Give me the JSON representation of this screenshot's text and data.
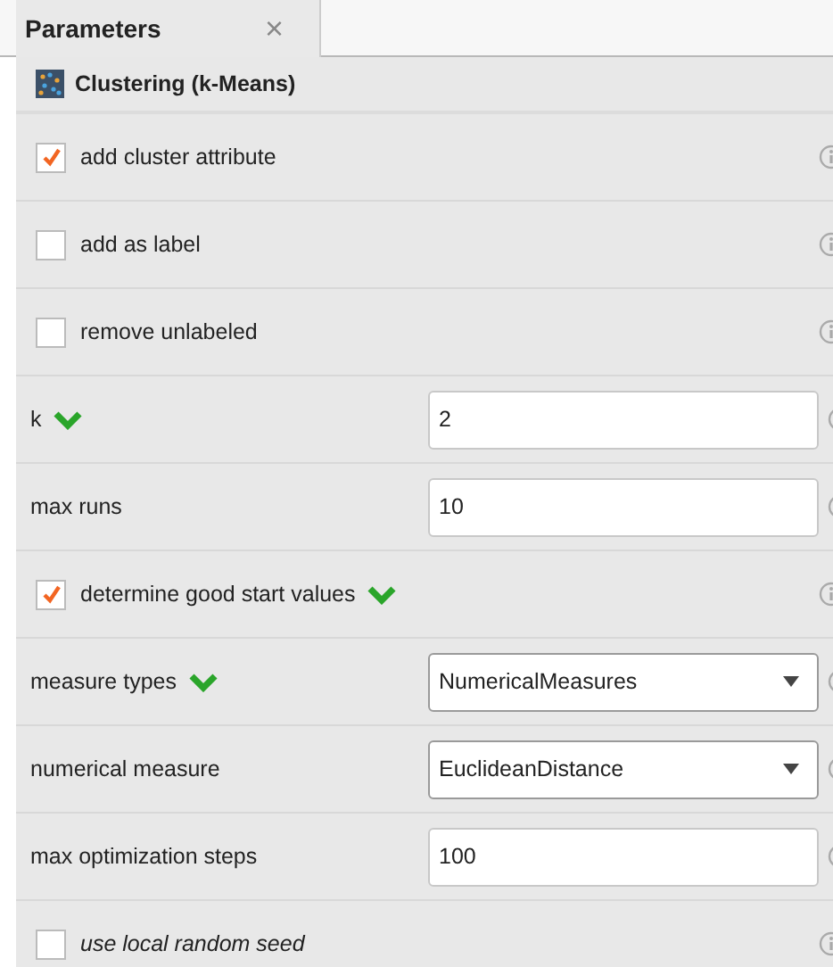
{
  "tab": {
    "label": "Parameters",
    "close": "×"
  },
  "operator": {
    "title": "Clustering (k-Means)"
  },
  "parameters": [
    {
      "kind": "checkbox",
      "label": "add cluster attribute",
      "checked": true,
      "important": false,
      "expert": false
    },
    {
      "kind": "checkbox",
      "label": "add as label",
      "checked": false,
      "important": false,
      "expert": false
    },
    {
      "kind": "checkbox",
      "label": "remove unlabeled",
      "checked": false,
      "important": false,
      "expert": false
    },
    {
      "kind": "text",
      "label": "k",
      "value": "2",
      "important": true,
      "expert": false
    },
    {
      "kind": "text",
      "label": "max runs",
      "value": "10",
      "important": false,
      "expert": false
    },
    {
      "kind": "checkbox",
      "label": "determine good start values",
      "checked": true,
      "important": true,
      "expert": false
    },
    {
      "kind": "select",
      "label": "measure types",
      "value": "NumericalMeasures",
      "important": true,
      "expert": false
    },
    {
      "kind": "select",
      "label": "numerical measure",
      "value": "EuclideanDistance",
      "important": false,
      "expert": false
    },
    {
      "kind": "text",
      "label": "max optimization steps",
      "value": "100",
      "important": false,
      "expert": false
    },
    {
      "kind": "checkbox",
      "label": "use local random seed",
      "checked": false,
      "important": false,
      "expert": true
    }
  ]
}
